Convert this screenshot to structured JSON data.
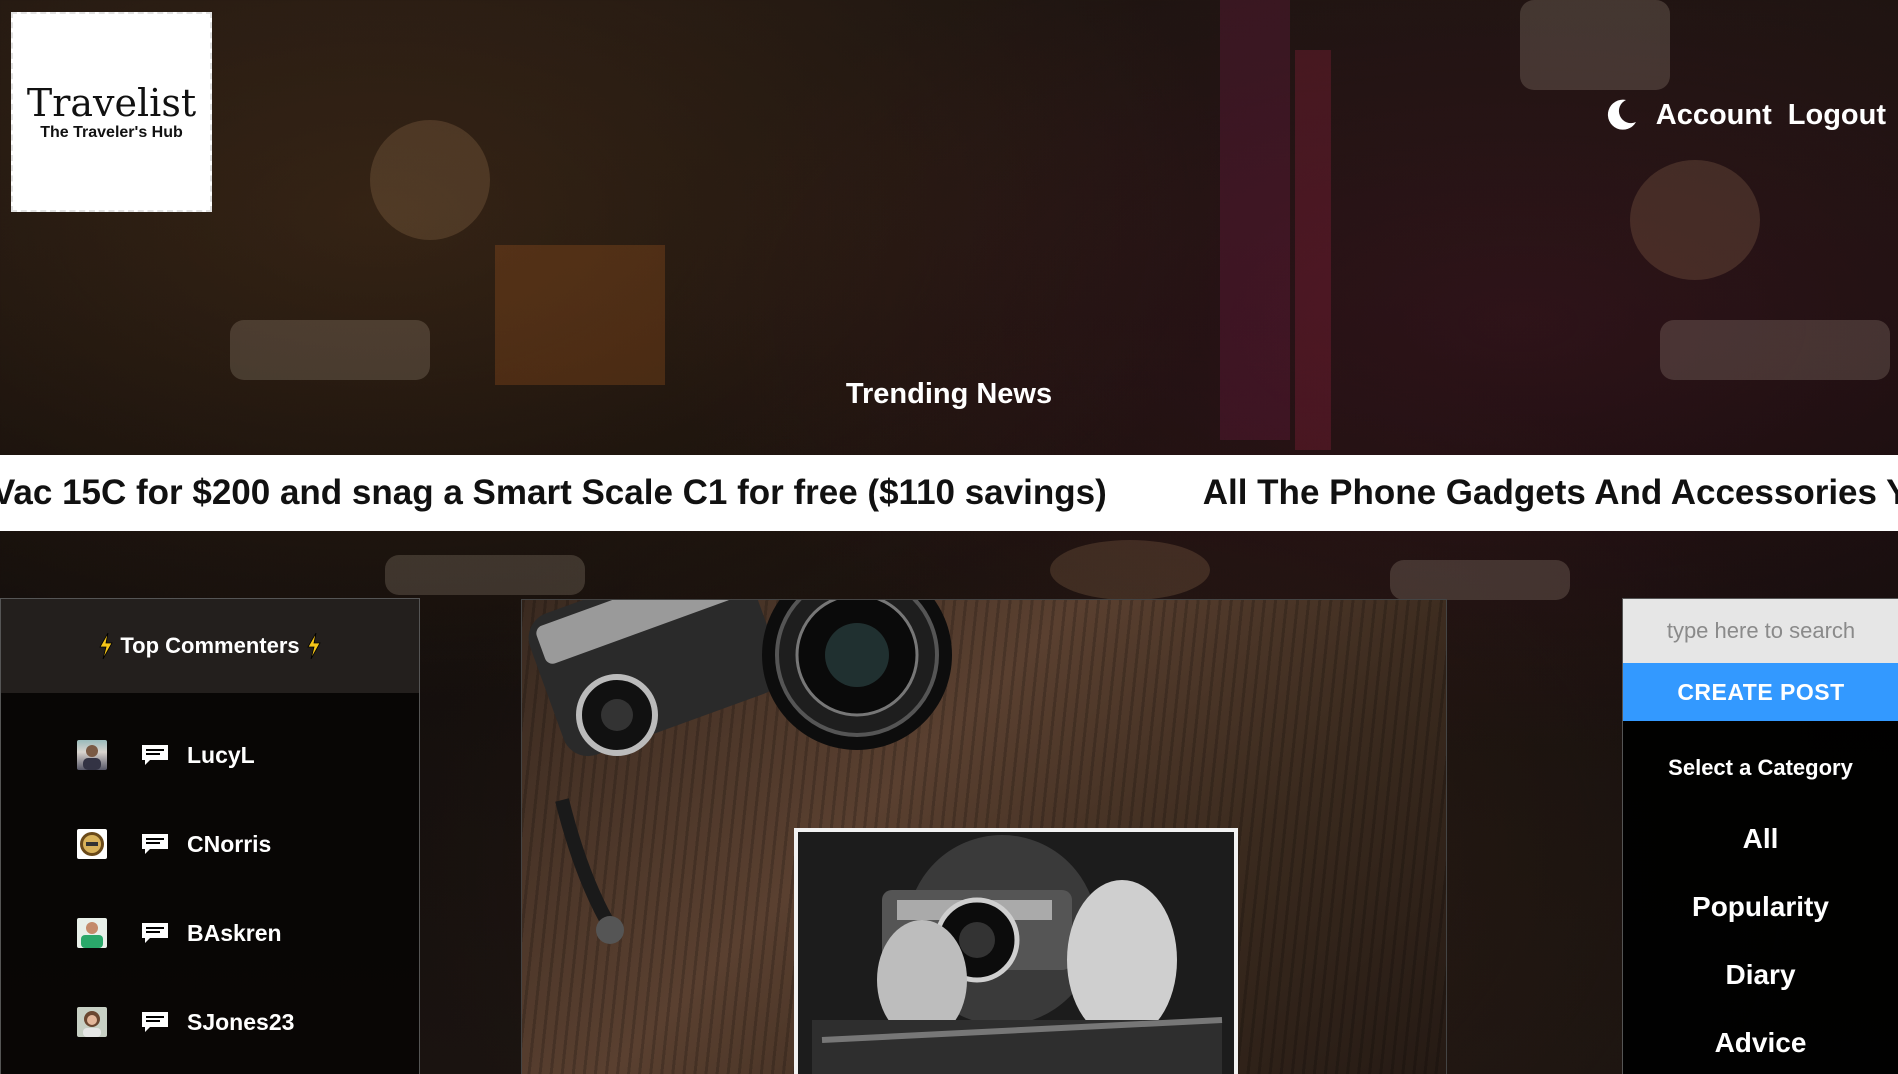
{
  "brand": {
    "title": "Travelist",
    "subtitle": "The Traveler's Hub"
  },
  "nav": {
    "theme_icon": "moon-icon",
    "account_label": "Account",
    "logout_label": "Logout"
  },
  "trending": {
    "label": "Trending News",
    "headlines": [
      "Vac 15C for $200 and snag a Smart Scale C1 for free ($110 savings)",
      "All The Phone Gadgets And Accessories Y"
    ]
  },
  "top_commenters": {
    "title": "Top Commenters",
    "title_icon": "lightning-bolt-icon",
    "items": [
      {
        "name": "LucyL",
        "avatar": "avatar-photo",
        "icon": "comment-icon"
      },
      {
        "name": "CNorris",
        "avatar": "avatar-badge",
        "icon": "comment-icon"
      },
      {
        "name": "BAskren",
        "avatar": "avatar-photo",
        "icon": "comment-icon"
      },
      {
        "name": "SJones23",
        "avatar": "avatar-photo",
        "icon": "comment-icon"
      }
    ]
  },
  "feature_image": {
    "icon": "camera-photo-image"
  },
  "sidebar": {
    "search_placeholder": "type here to search",
    "create_label": "CREATE POST",
    "category_title": "Select a Category",
    "categories": [
      "All",
      "Popularity",
      "Diary",
      "Advice"
    ]
  },
  "colors": {
    "accent": "#3399ff",
    "panel_bg": "#000000",
    "ticker_bg": "#ffffff",
    "bolt": "#f5c518"
  }
}
